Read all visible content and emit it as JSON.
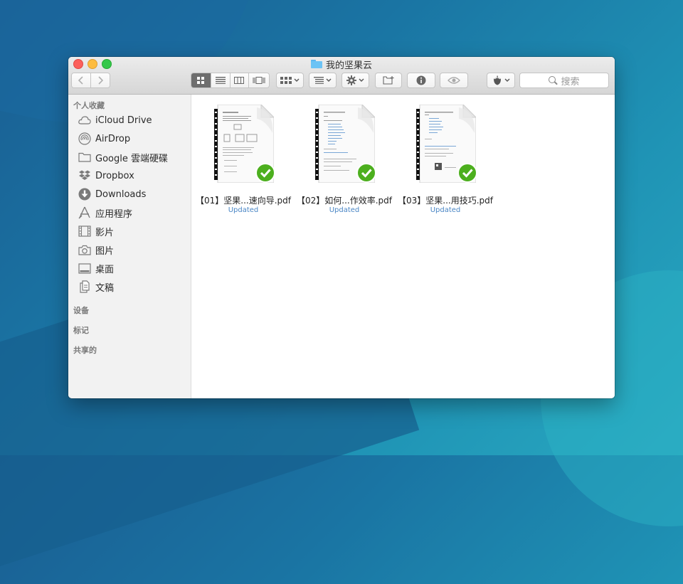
{
  "window": {
    "title": "我的坚果云"
  },
  "toolbar": {
    "back_icon": "chevron-left",
    "forward_icon": "chevron-right",
    "view_modes": [
      "icon-view",
      "list-view",
      "column-view",
      "cover-flow-view"
    ],
    "active_view": "icon-view",
    "group_icon": "group-grid",
    "arrange_icon": "arrange-list",
    "action_icon": "gear",
    "new_folder_icon": "new-folder",
    "info_icon": "info",
    "quicklook_icon": "eye",
    "nutstore_icon": "acorn",
    "search_placeholder": "搜索"
  },
  "sidebar": {
    "favorites_header": "个人收藏",
    "favorites": [
      {
        "label": "iCloud Drive",
        "icon": "cloud"
      },
      {
        "label": "AirDrop",
        "icon": "airdrop"
      },
      {
        "label": "Google 雲端硬碟",
        "icon": "folder"
      },
      {
        "label": "Dropbox",
        "icon": "dropbox"
      },
      {
        "label": "Downloads",
        "icon": "download"
      },
      {
        "label": "应用程序",
        "icon": "applications"
      },
      {
        "label": "影片",
        "icon": "film"
      },
      {
        "label": "图片",
        "icon": "camera"
      },
      {
        "label": "桌面",
        "icon": "desktop"
      },
      {
        "label": "文稿",
        "icon": "documents"
      }
    ],
    "devices_header": "设备",
    "tags_header": "标记",
    "shared_header": "共享的"
  },
  "files": [
    {
      "name": "【01】坚果...速向导.pdf",
      "status": "Updated",
      "icon": "pdf-synced"
    },
    {
      "name": "【02】如何...作效率.pdf",
      "status": "Updated",
      "icon": "pdf-synced"
    },
    {
      "name": "【03】坚果...用技巧.pdf",
      "status": "Updated",
      "icon": "pdf-synced"
    }
  ],
  "colors": {
    "status_text": "#4a86c5",
    "sync_badge": "#4caf1e",
    "close": "#fc605c",
    "minimize": "#fdbc40",
    "zoom": "#34c84a"
  }
}
